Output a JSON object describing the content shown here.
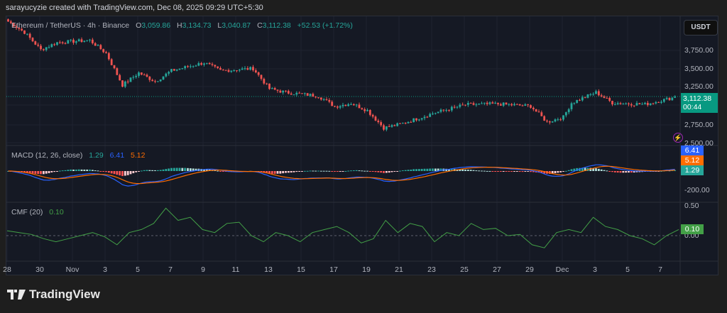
{
  "credit": "sarayucyzie created with TradingView.com, Dec 08, 2025 09:29 UTC+5:30",
  "legend": {
    "symbol": "Ethereum / TetherUS · 4h · Binance",
    "o_label": "O",
    "o": "3,059.86",
    "h_label": "H",
    "h": "3,134.73",
    "l_label": "L",
    "l": "3,040.87",
    "c_label": "C",
    "c": "3,112.38",
    "change": "+52.53 (+1.72%)"
  },
  "currency_button": "USDT",
  "price_tag": {
    "price": "3,112.38",
    "countdown": "00:44"
  },
  "macd_legend": {
    "label": "MACD (12, 26, close)",
    "hist": "1.29",
    "macd": "6.41",
    "signal": "5.12"
  },
  "cmf_legend": {
    "label": "CMF (20)",
    "value": "0.10"
  },
  "colors": {
    "up": "#26a69a",
    "down": "#ef5350",
    "macd": "#2962ff",
    "signal": "#ff6d00",
    "cmf": "#43a047",
    "bg": "#151924"
  },
  "brand": "TradingView",
  "chart_data": [
    {
      "type": "candlestick",
      "title": "Ethereum / TetherUS · 4h · Binance",
      "y_ticks": [
        "3,750.00",
        "3,500.00",
        "3,250.00",
        "2,750.00",
        "2,500.00"
      ],
      "ylim": [
        2500,
        4200
      ],
      "x_ticks": [
        "28",
        "30",
        "Nov",
        "3",
        "5",
        "7",
        "9",
        "11",
        "13",
        "15",
        "17",
        "19",
        "21",
        "23",
        "25",
        "27",
        "29",
        "Dec",
        "3",
        "5",
        "7"
      ],
      "close_path": [
        [
          "Oct 28",
          4150
        ],
        [
          "Oct 29",
          4000
        ],
        [
          "Oct 30",
          3760
        ],
        [
          "Oct 31",
          3860
        ],
        [
          "Nov 2",
          3890
        ],
        [
          "Nov 3",
          3710
        ],
        [
          "Nov 4",
          3270
        ],
        [
          "Nov 5",
          3440
        ],
        [
          "Nov 6",
          3320
        ],
        [
          "Nov 7",
          3470
        ],
        [
          "Nov 9",
          3580
        ],
        [
          "Nov 10",
          3470
        ],
        [
          "Nov 12",
          3500
        ],
        [
          "Nov 13",
          3220
        ],
        [
          "Nov 14",
          3170
        ],
        [
          "Nov 16",
          3120
        ],
        [
          "Nov 17",
          2975
        ],
        [
          "Nov 18",
          3020
        ],
        [
          "Nov 19",
          2920
        ],
        [
          "Nov 20",
          2680
        ],
        [
          "Nov 21",
          2730
        ],
        [
          "Nov 23",
          2880
        ],
        [
          "Nov 25",
          3000
        ],
        [
          "Nov 27",
          3010
        ],
        [
          "Nov 29",
          2980
        ],
        [
          "Nov 30",
          2760
        ],
        [
          "Dec 1",
          2830
        ],
        [
          "Dec 1.5",
          3025
        ],
        [
          "Dec 3",
          3170
        ],
        [
          "Dec 4",
          3025
        ],
        [
          "Dec 6",
          3005
        ],
        [
          "Dec 8",
          3112.38
        ]
      ]
    },
    {
      "type": "line",
      "title": "MACD (12, 26, close)",
      "y_ticks": [
        "-200.00"
      ],
      "last": {
        "macd": 6.41,
        "signal": 5.12,
        "histogram": 1.29
      }
    },
    {
      "type": "line",
      "title": "CMF (20)",
      "y_ticks": [
        "0.50",
        "0.00"
      ],
      "last": 0.1,
      "values": [
        0.08,
        0.05,
        0.02,
        -0.05,
        -0.1,
        -0.05,
        0.0,
        0.05,
        -0.02,
        -0.15,
        0.05,
        0.1,
        0.2,
        0.45,
        0.25,
        0.3,
        0.1,
        0.05,
        0.2,
        0.22,
        0.0,
        -0.1,
        0.05,
        0.0,
        -0.1,
        0.05,
        0.1,
        0.15,
        0.05,
        -0.12,
        -0.05,
        0.25,
        0.05,
        0.2,
        0.15,
        -0.1,
        0.05,
        0.0,
        0.2,
        0.1,
        0.12,
        0.0,
        0.02,
        -0.15,
        -0.2,
        0.05,
        0.1,
        0.05,
        0.3,
        0.15,
        0.1,
        0.0,
        -0.05,
        -0.15,
        0.0,
        0.1
      ]
    }
  ]
}
